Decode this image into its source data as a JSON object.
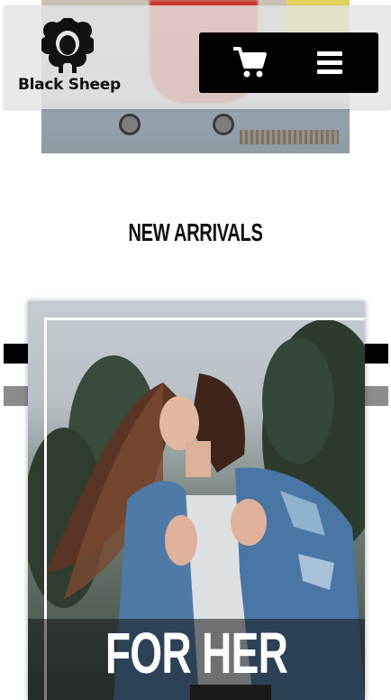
{
  "brand": {
    "name": "Black Sheep",
    "logo_icon": "sheep-logo-icon"
  },
  "header": {
    "cart_icon": "cart-icon",
    "menu_icon": "hamburger-menu-icon",
    "background": "#e4e4e4",
    "actions_background": "#000000"
  },
  "hero": {
    "image": "street-skateboard-photo"
  },
  "section": {
    "title": "NEW ARRIVALS"
  },
  "products": [
    {
      "caption": "FOR HER",
      "image": "woman-denim-jacket-photo"
    }
  ],
  "colors": {
    "text": "#111111",
    "accent_dark": "#000000",
    "accent_gray": "#8c8c8c",
    "caption_text": "#ffffff"
  }
}
